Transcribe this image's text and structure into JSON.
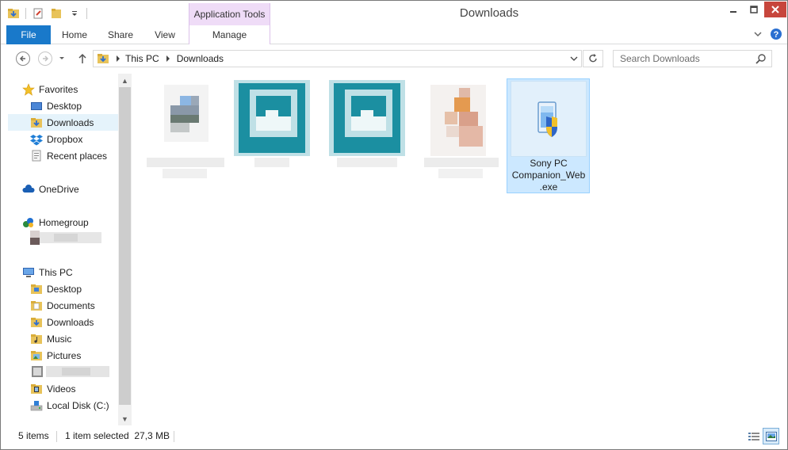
{
  "window": {
    "title": "Downloads",
    "contextual_tab_group": "Application Tools"
  },
  "ribbon": {
    "tabs": [
      "File",
      "Home",
      "Share",
      "View",
      "Manage"
    ],
    "help_icon": "help-icon",
    "collapse_icon": "chevron-down-icon"
  },
  "navbar": {
    "breadcrumb": [
      "This PC",
      "Downloads"
    ],
    "search_placeholder": "Search Downloads"
  },
  "navpane": {
    "favorites": {
      "label": "Favorites",
      "items": [
        "Desktop",
        "Downloads",
        "Dropbox",
        "Recent places"
      ]
    },
    "onedrive": "OneDrive",
    "homegroup": "Homegroup",
    "thispc": {
      "label": "This PC",
      "items": [
        "Desktop",
        "Documents",
        "Downloads",
        "Music",
        "Pictures",
        "Videos",
        "Local Disk (C:)"
      ]
    },
    "selected_item": "Downloads"
  },
  "content": {
    "files": [
      {
        "name": "",
        "blurred": true
      },
      {
        "name": "",
        "blurred": true
      },
      {
        "name": "",
        "blurred": true
      },
      {
        "name": "",
        "blurred": true
      },
      {
        "name": "Sony PC Companion_Web .exe",
        "line1": "Sony PC",
        "line2": "Companion_Web",
        "line3": ".exe",
        "selected": true
      }
    ]
  },
  "statusbar": {
    "item_count": "5 items",
    "selection": "1 item selected  27,3 MB"
  },
  "colors": {
    "file_tab": "#1979ca",
    "context_tab": "#efdcf7",
    "selection": "#cce8ff",
    "close_button": "#c7463c",
    "teal_thumb": "#1b8fa1"
  }
}
